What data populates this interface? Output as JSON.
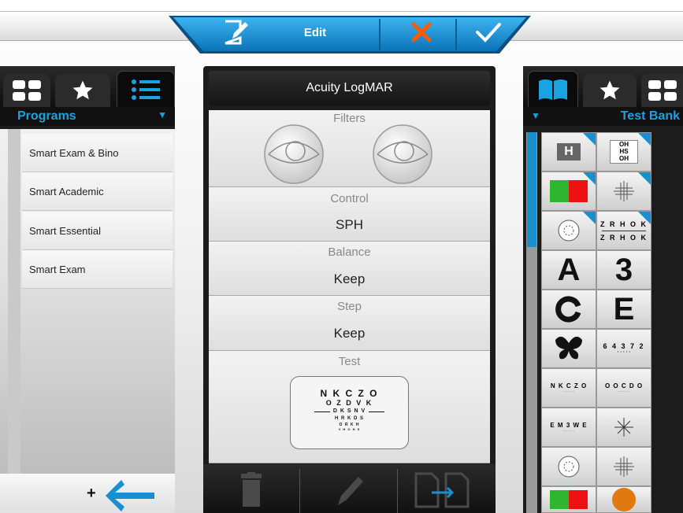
{
  "toolbar": {
    "edit_label": "Edit",
    "icons": [
      "edit-note-icon",
      "close-icon",
      "check-icon"
    ],
    "accent": "#1a8fd0",
    "close_color": "#ff5a00"
  },
  "left_panel": {
    "tabs": [
      "grid-icon",
      "star-icon",
      "list-icon"
    ],
    "header": "Programs",
    "items": [
      {
        "label": "Smart Exam & Bino"
      },
      {
        "label": "Smart Academic"
      },
      {
        "label": "Smart Essential"
      },
      {
        "label": "Smart Exam"
      }
    ],
    "footer_plus": "+"
  },
  "center_panel": {
    "title": "Acuity LogMAR",
    "filters_label": "Filters",
    "control_label": "Control",
    "control_value": "SPH",
    "balance_label": "Balance",
    "balance_value": "Keep",
    "step_label": "Step",
    "step_value": "Keep",
    "test_label": "Test",
    "test_chart_lines": [
      "N K C Z O",
      "O Z D V K",
      "D K S N V",
      "H R K D S",
      "O R K H",
      "V H O N S"
    ],
    "footer_icons": [
      "trash-icon",
      "pencil-icon",
      "copy-pages-icon"
    ]
  },
  "right_panel": {
    "tabs": [
      "book-icon",
      "star-icon",
      "grid-icon"
    ],
    "header": "Test Bank",
    "tiles_text": {
      "t3a": "A",
      "t3b": "3",
      "t4b": "E",
      "zr1": "Z R H O K",
      "zr2": "Z R H O K",
      "numbers": "6 4 3 7 2",
      "letters1": "N K C Z O",
      "letters2": "O O C D O",
      "letters3": "E M 3 W E"
    }
  }
}
